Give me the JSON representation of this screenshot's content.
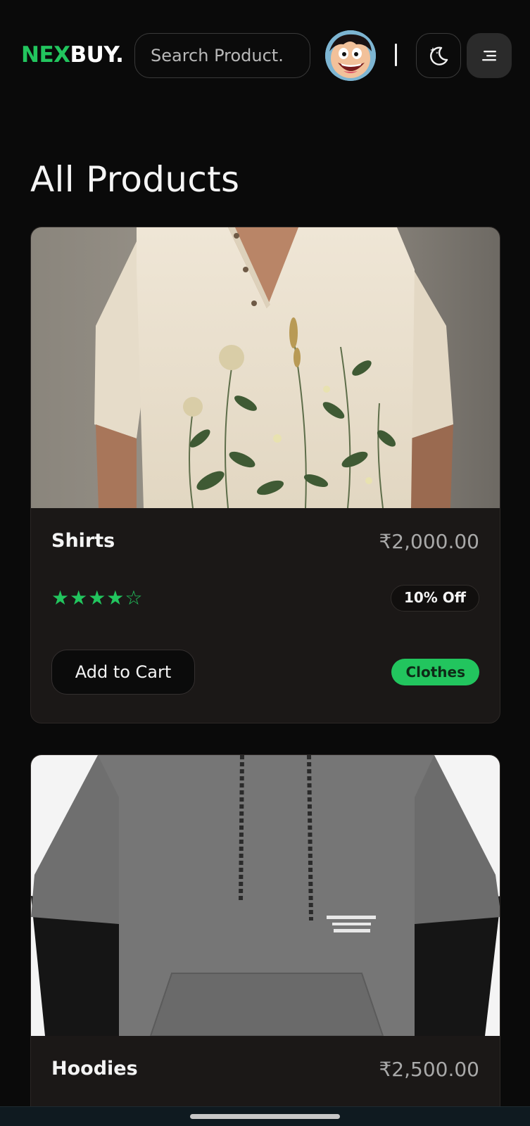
{
  "header": {
    "logo_accent": "NEX",
    "logo_rest": "BUY.",
    "search_placeholder": "Search Product.",
    "theme_icon": "moon-stars-icon",
    "menu_icon": "menu-icon"
  },
  "section_title": "All Products",
  "products": [
    {
      "name": "Shirts",
      "price": "₹2,000.00",
      "rating": 4,
      "rating_max": 5,
      "stars_text": "★★★★☆",
      "discount": "10% Off",
      "add_to_cart": "Add to Cart",
      "category": "Clothes"
    },
    {
      "name": "Hoodies",
      "price": "₹2,500.00"
    }
  ],
  "colors": {
    "accent": "#22c55e",
    "background": "#0a0a0a",
    "card": "#1b1817"
  }
}
